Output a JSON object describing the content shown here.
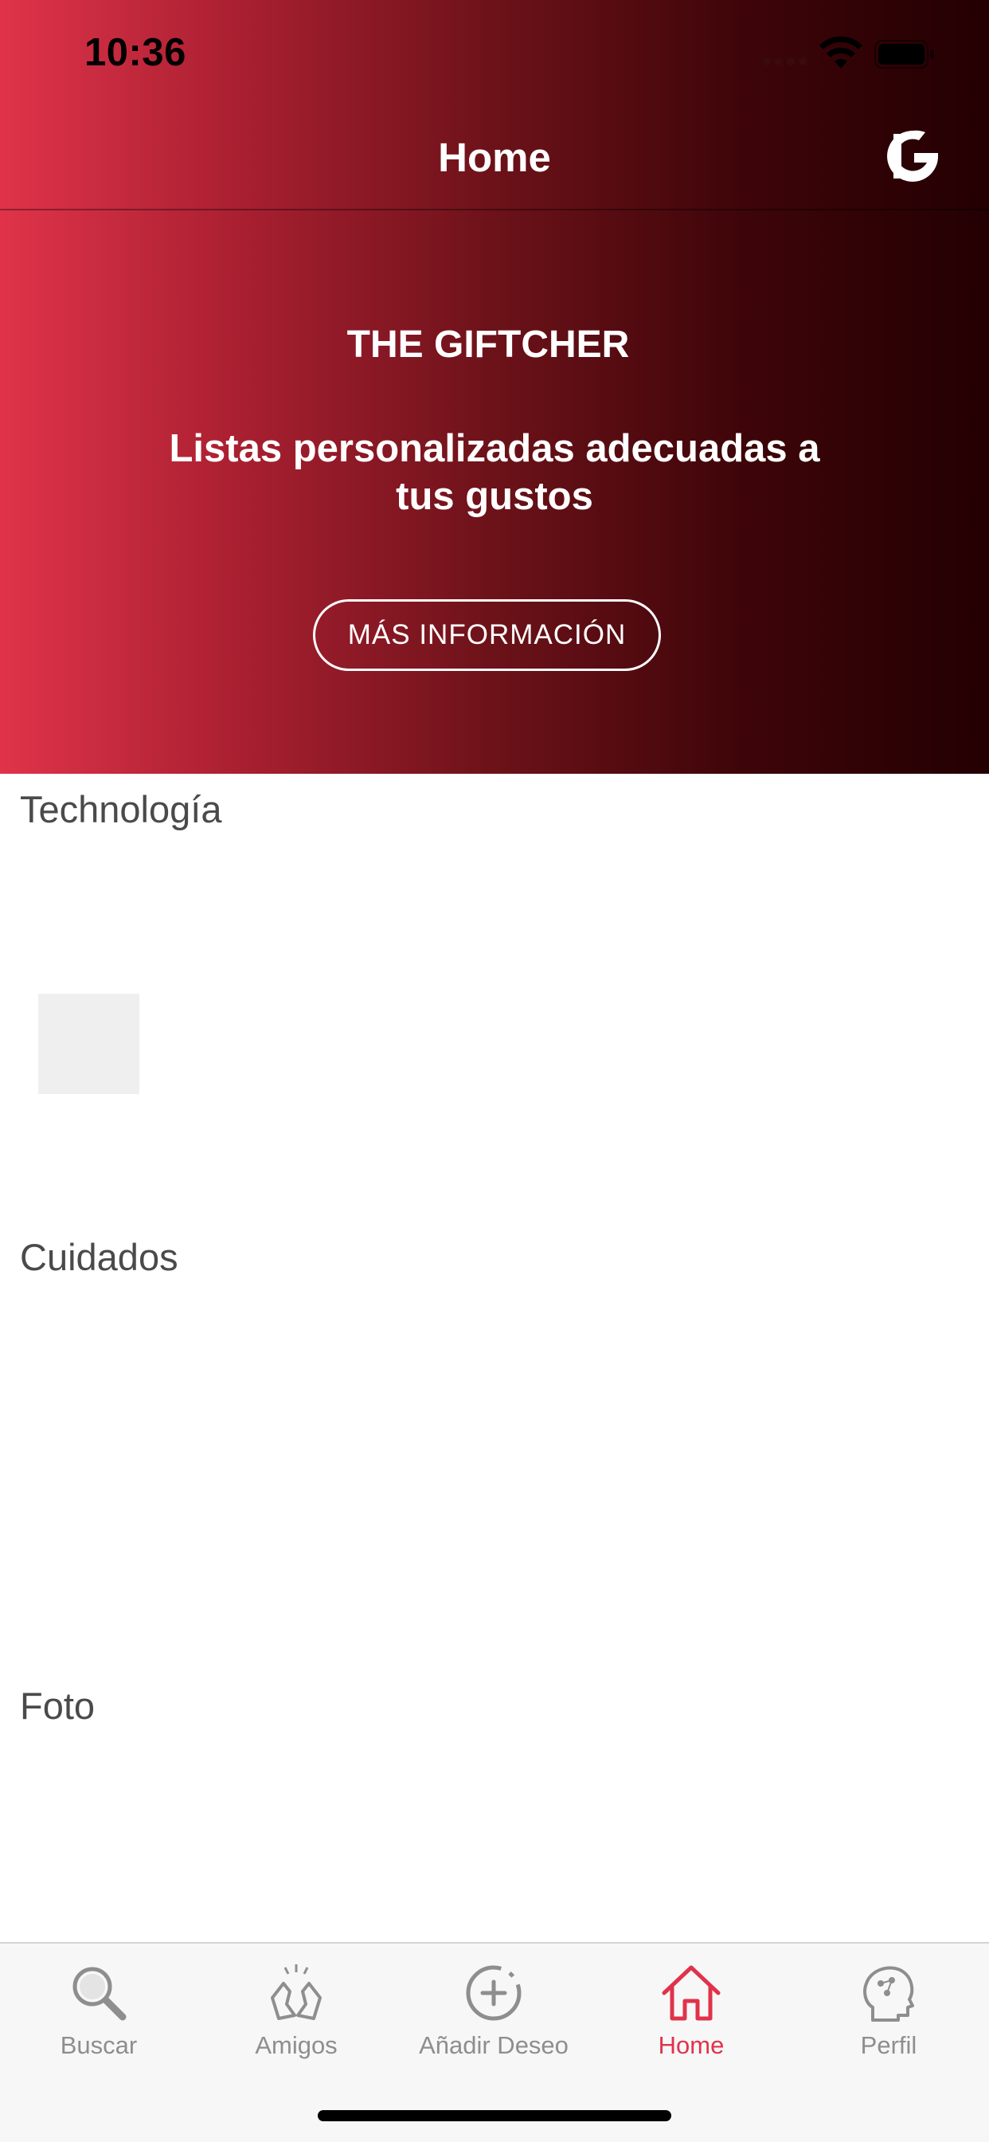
{
  "status_bar": {
    "time": "10:36"
  },
  "nav": {
    "title": "Home",
    "logo_icon": "giftcher-logo-icon"
  },
  "hero": {
    "title": "THE GIFTCHER",
    "subtitle": "Listas personalizadas adecuadas a tus gustos",
    "button_label": "MÁS INFORMACIÓN",
    "gradient_colors": [
      "#e0334a",
      "#230002"
    ]
  },
  "sections": [
    {
      "title": "Technología"
    },
    {
      "title": "Cuidados"
    },
    {
      "title": "Foto"
    }
  ],
  "tab_bar": {
    "items": [
      {
        "label": "Buscar",
        "icon": "search-icon"
      },
      {
        "label": "Amigos",
        "icon": "friends-icon"
      },
      {
        "label": "Añadir Deseo",
        "icon": "add-circle-icon"
      },
      {
        "label": "Home",
        "icon": "home-icon",
        "active": true
      },
      {
        "label": "Perfil",
        "icon": "profile-head-icon"
      }
    ],
    "active_color": "#e0334a",
    "inactive_color": "#8e8e8e"
  }
}
